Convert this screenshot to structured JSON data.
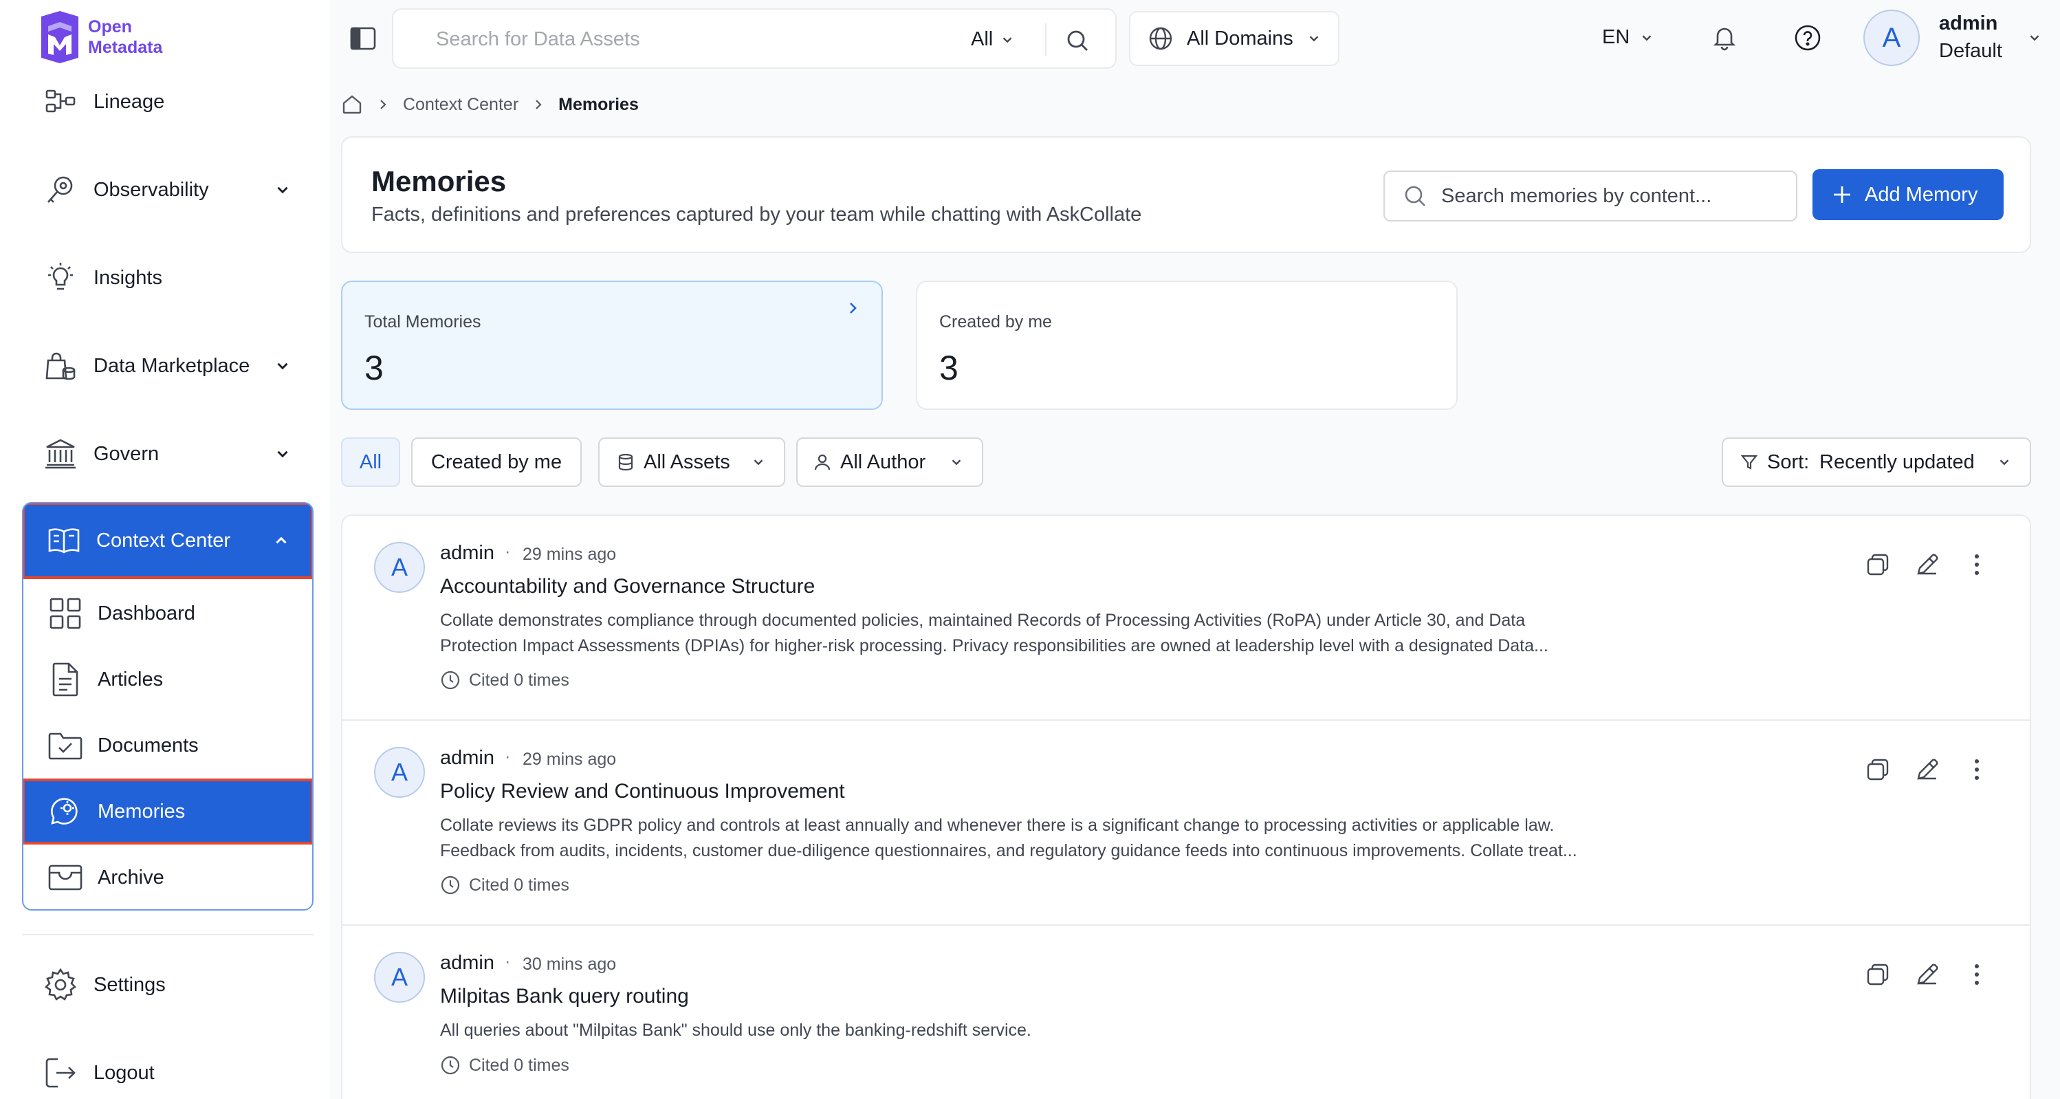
{
  "brand": {
    "line1": "Open",
    "line2": "Metadata",
    "color": "#7147e8"
  },
  "sidebar": {
    "items": [
      {
        "label": "Lineage",
        "icon": "lineage-icon"
      },
      {
        "label": "Observability",
        "icon": "observability-icon"
      },
      {
        "label": "Insights",
        "icon": "insights-icon"
      },
      {
        "label": "Data Marketplace",
        "icon": "marketplace-icon"
      },
      {
        "label": "Govern",
        "icon": "govern-icon"
      }
    ],
    "context_center": {
      "label": "Context Center",
      "expanded": true,
      "children": [
        {
          "label": "Dashboard",
          "icon": "dashboard-icon"
        },
        {
          "label": "Articles",
          "icon": "articles-icon"
        },
        {
          "label": "Documents",
          "icon": "documents-icon"
        },
        {
          "label": "Memories",
          "icon": "memories-icon",
          "active": true
        },
        {
          "label": "Archive",
          "icon": "archive-icon"
        }
      ]
    },
    "bottom": [
      {
        "label": "Settings",
        "icon": "gear-icon"
      },
      {
        "label": "Logout",
        "icon": "logout-icon"
      }
    ]
  },
  "topbar": {
    "search_placeholder": "Search for Data Assets",
    "search_scope": "All",
    "domain": "All Domains",
    "language": "EN",
    "user": {
      "initial": "A",
      "name": "admin",
      "role": "Default"
    }
  },
  "breadcrumb": {
    "items": [
      "Context Center"
    ],
    "current": "Memories"
  },
  "header": {
    "title": "Memories",
    "subtitle": "Facts, definitions and preferences captured by your team while chatting with AskCollate",
    "search_placeholder": "Search memories by content...",
    "add_button": "Add Memory"
  },
  "stats": [
    {
      "label": "Total Memories",
      "value": "3"
    },
    {
      "label": "Created by me",
      "value": "3"
    }
  ],
  "filters": {
    "all": "All",
    "created_by_me": "Created by me",
    "assets": "All Assets",
    "author": "All Author",
    "sort_prefix": "Sort:",
    "sort_value": "Recently updated"
  },
  "memories": [
    {
      "initial": "A",
      "author": "admin",
      "time": "29 mins ago",
      "title": "Accountability and Governance Structure",
      "body_line1": "Collate demonstrates compliance through documented policies, maintained Records of Processing Activities (RoPA) under Article 30, and Data",
      "body_line2": "Protection Impact Assessments (DPIAs) for higher-risk processing. Privacy responsibilities are owned at leadership level with a designated Data...",
      "cited": "Cited 0 times"
    },
    {
      "initial": "A",
      "author": "admin",
      "time": "29 mins ago",
      "title": "Policy Review and Continuous Improvement",
      "body_line1": "Collate reviews its GDPR policy and controls at least annually and whenever there is a significant change to processing activities or applicable law.",
      "body_line2": "Feedback from audits, incidents, customer due-diligence questionnaires, and regulatory guidance feeds into continuous improvements. Collate treat...",
      "cited": "Cited 0 times"
    },
    {
      "initial": "A",
      "author": "admin",
      "time": "30 mins ago",
      "title": "Milpitas Bank query routing",
      "body_line1": "All queries about \"Milpitas Bank\" should use only the banking-redshift service.",
      "body_line2": "",
      "cited": "Cited 0 times"
    }
  ],
  "colors": {
    "accent": "#2162d9",
    "highlight_border": "#e6462f"
  }
}
